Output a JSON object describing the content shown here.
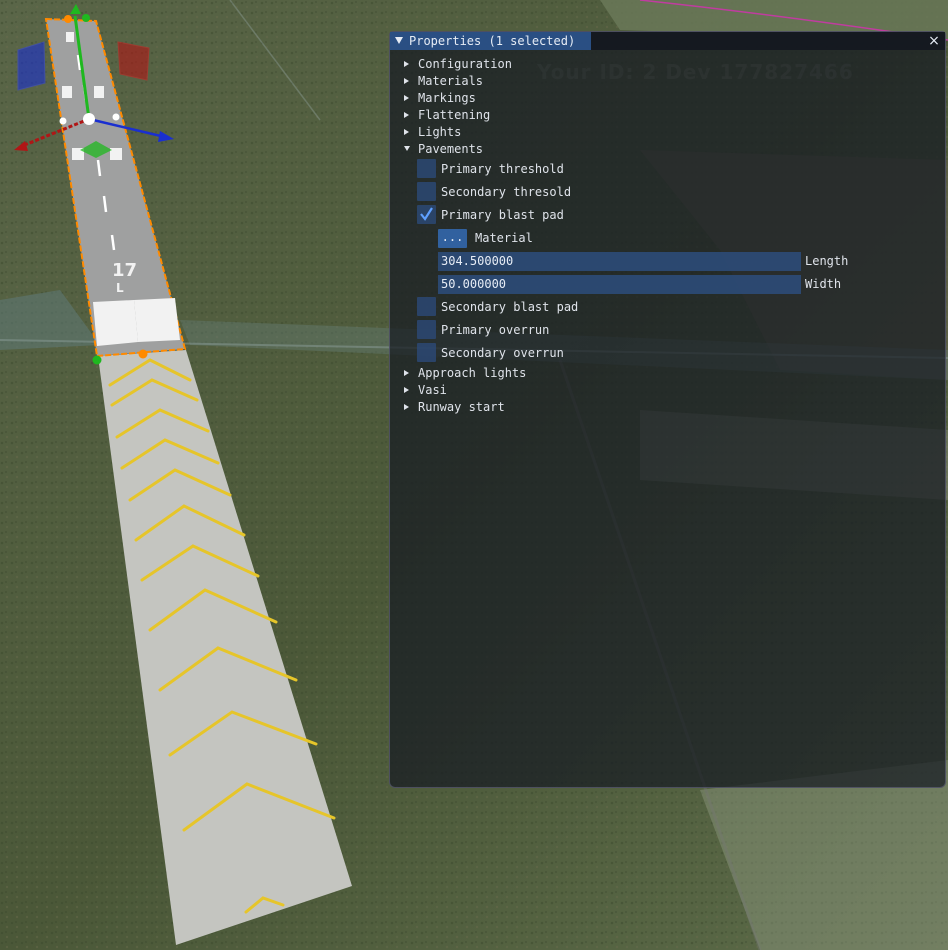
{
  "scene": {
    "runway_number": "17",
    "watermark": "Your ID: 2 Dev 177827466"
  },
  "panel": {
    "title": "Properties (1 selected)",
    "close_glyph": "×",
    "sections_top": [
      "Configuration",
      "Materials",
      "Markings",
      "Flattening",
      "Lights"
    ],
    "pavements": {
      "label": "Pavements",
      "items": [
        {
          "label": "Primary threshold",
          "checked": false
        },
        {
          "label": "Secondary thresold",
          "checked": false
        },
        {
          "label": "Primary blast pad",
          "checked": true
        }
      ],
      "material_button": "...",
      "material_label": "Material",
      "length_value": "304.500000",
      "length_label": "Length",
      "width_value": "50.000000",
      "width_label": "Width",
      "items_after": [
        {
          "label": "Secondary blast pad",
          "checked": false
        },
        {
          "label": "Primary overrun",
          "checked": false
        },
        {
          "label": "Secondary overrun",
          "checked": false
        }
      ]
    },
    "sections_bottom": [
      "Approach lights",
      "Vasi",
      "Runway start"
    ]
  },
  "colors": {
    "accent": "#2a4f83",
    "checkbox": "#2c4a78",
    "gizmo_x": "#b01616",
    "gizmo_y": "#1fb81f",
    "gizmo_z": "#1a2fd0",
    "selection_outline": "#ff8a00",
    "chevron": "#e6c52a"
  }
}
